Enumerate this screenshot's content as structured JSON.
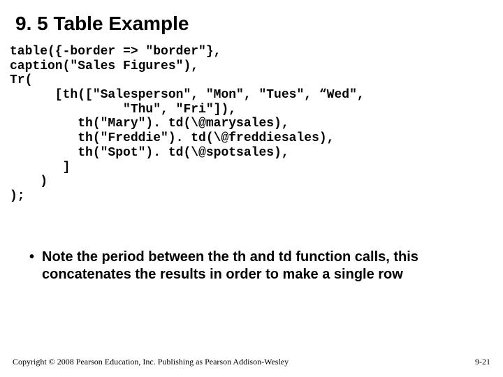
{
  "title": "9. 5 Table Example",
  "code": "table({-border => \"border\"},\ncaption(\"Sales Figures\"),\nTr(\n      [th([\"Salesperson\", \"Mon\", \"Tues\", “Wed\",\n               \"Thu\", \"Fri\"]),\n         th(\"Mary\"). td(\\@marysales),\n         th(\"Freddie\"). td(\\@freddiesales),\n         th(\"Spot\"). td(\\@spotsales),\n       ]\n    )\n);",
  "note": "Note the period between the th and td function calls, this concatenates the results in order to make a single row",
  "footer": {
    "copyright": "Copyright © 2008 Pearson Education, Inc. Publishing as Pearson Addison-Wesley",
    "page": "9-21"
  }
}
